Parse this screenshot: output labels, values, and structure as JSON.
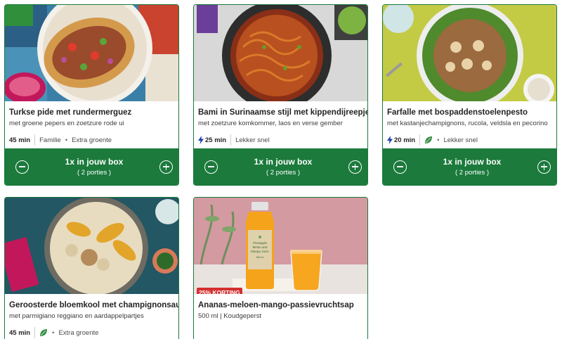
{
  "cards": [
    {
      "title": "Turkse pide met rundermerguez",
      "subtitle": "met groene pepers en zoetzure rode ui",
      "time": "45 min",
      "tags": [
        "Familie",
        "Extra groente"
      ],
      "box": {
        "label": "1x in jouw box",
        "portions": "( 2 porties )"
      }
    },
    {
      "title": "Bami in Surinaamse stijl met kippendijreepjes",
      "subtitle": "met zoetzure komkommer, laos en verse gember",
      "time": "25 min",
      "tags": [
        "Lekker snel"
      ],
      "box": {
        "label": "1x in jouw box",
        "portions": "( 2 porties )"
      }
    },
    {
      "title": "Farfalle met bospaddenstoelenpesto",
      "subtitle": "met kastanjechampignons, rucola, veldsla en pecorino",
      "time": "20 min",
      "tags": [
        "Lekker snel"
      ],
      "box": {
        "label": "1x in jouw box",
        "portions": "( 2 porties )"
      }
    },
    {
      "title": "Geroosterde bloemkool met champignonsaus",
      "subtitle": "met parmigiano reggiano en aardappelpartjes",
      "time": "45 min",
      "tags": [
        "Extra groente"
      ]
    },
    {
      "title": "Ananas-meloen-mango-passievruchtsap",
      "subtitle": "500 ml | Koudgeperst",
      "badge": "25% KORTING",
      "bottle_label": [
        "Pineapple",
        "Melon and",
        "Mango Juice",
        "500 ml"
      ]
    }
  ],
  "colors": {
    "brand_green": "#1b7a3c",
    "badge_red": "#d32f2f"
  },
  "icons": [
    "minus-circle-icon",
    "plus-circle-icon",
    "lightning-bolt-icon",
    "leaf-icon"
  ]
}
